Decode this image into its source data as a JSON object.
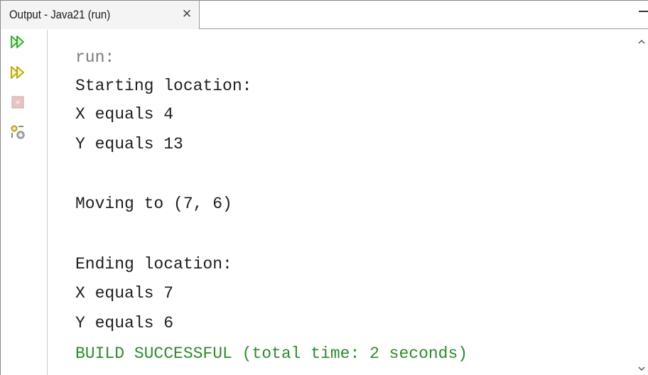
{
  "tab": {
    "title": "Output - Java21 (run)",
    "close_glyph": "✕"
  },
  "gutter": {
    "buttons": [
      {
        "icon": "rerun-icon",
        "color": "#2aa52a"
      },
      {
        "icon": "rerun-with-options-icon",
        "color": "#b0a400"
      },
      {
        "icon": "stop-icon",
        "color": "#d9a6a6"
      },
      {
        "icon": "settings-icon",
        "color": "#8a8a8a"
      }
    ]
  },
  "console": {
    "run_label": "run:",
    "starting_header": "Starting location:",
    "start_x": "X equals 4",
    "start_y": "Y equals 13",
    "moving": "Moving to (7, 6)",
    "ending_header": "Ending location:",
    "end_x": "X equals 7",
    "end_y": "Y equals 6",
    "build_status": "BUILD SUCCESSFUL (total time: 2 seconds)"
  },
  "colors": {
    "success_text": "#2e8b2e",
    "run_label": "#7a7a7a",
    "text": "#1e1e1e"
  }
}
